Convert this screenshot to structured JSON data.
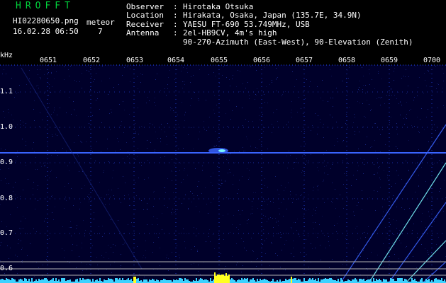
{
  "header": {
    "app_title": "HROFFT",
    "file_name": "HI02280650.png",
    "timestamp": "16.02.28 06:50",
    "meteor_label": "meteor",
    "meteor_count": "7"
  },
  "info": [
    {
      "label": "Observer",
      "value": "Hirotaka Otsuka"
    },
    {
      "label": "Location",
      "value": "Hirakata, Osaka, Japan (135.7E, 34.9N)"
    },
    {
      "label": "Receiver",
      "value": "YAESU FT-690 53.749MHz, USB"
    },
    {
      "label": "Antenna",
      "value": "2el-HB9CV, 4m's high"
    },
    {
      "label": "",
      "value": "90-270-Azimuth (East-West), 90-Elevation (Zenith)"
    }
  ],
  "spectrogram": {
    "unit_label": "kHz",
    "time_labels": [
      "0651",
      "0652",
      "0653",
      "0654",
      "0655",
      "0656",
      "0657",
      "0658",
      "0659",
      "0700"
    ],
    "freq_labels": [
      "1.1",
      "1.0",
      "0.9",
      "0.8",
      "0.7",
      "0.6"
    ],
    "colors": {
      "background": "#00002a",
      "noise": "#1c2c8c",
      "carrier": "#3a64ff",
      "echo": "#7cf8ff",
      "grid": "#2a50ff",
      "peak": "#ffff20",
      "spectrum": "#3cd2ff",
      "guide": "#b4b4b4"
    }
  }
}
